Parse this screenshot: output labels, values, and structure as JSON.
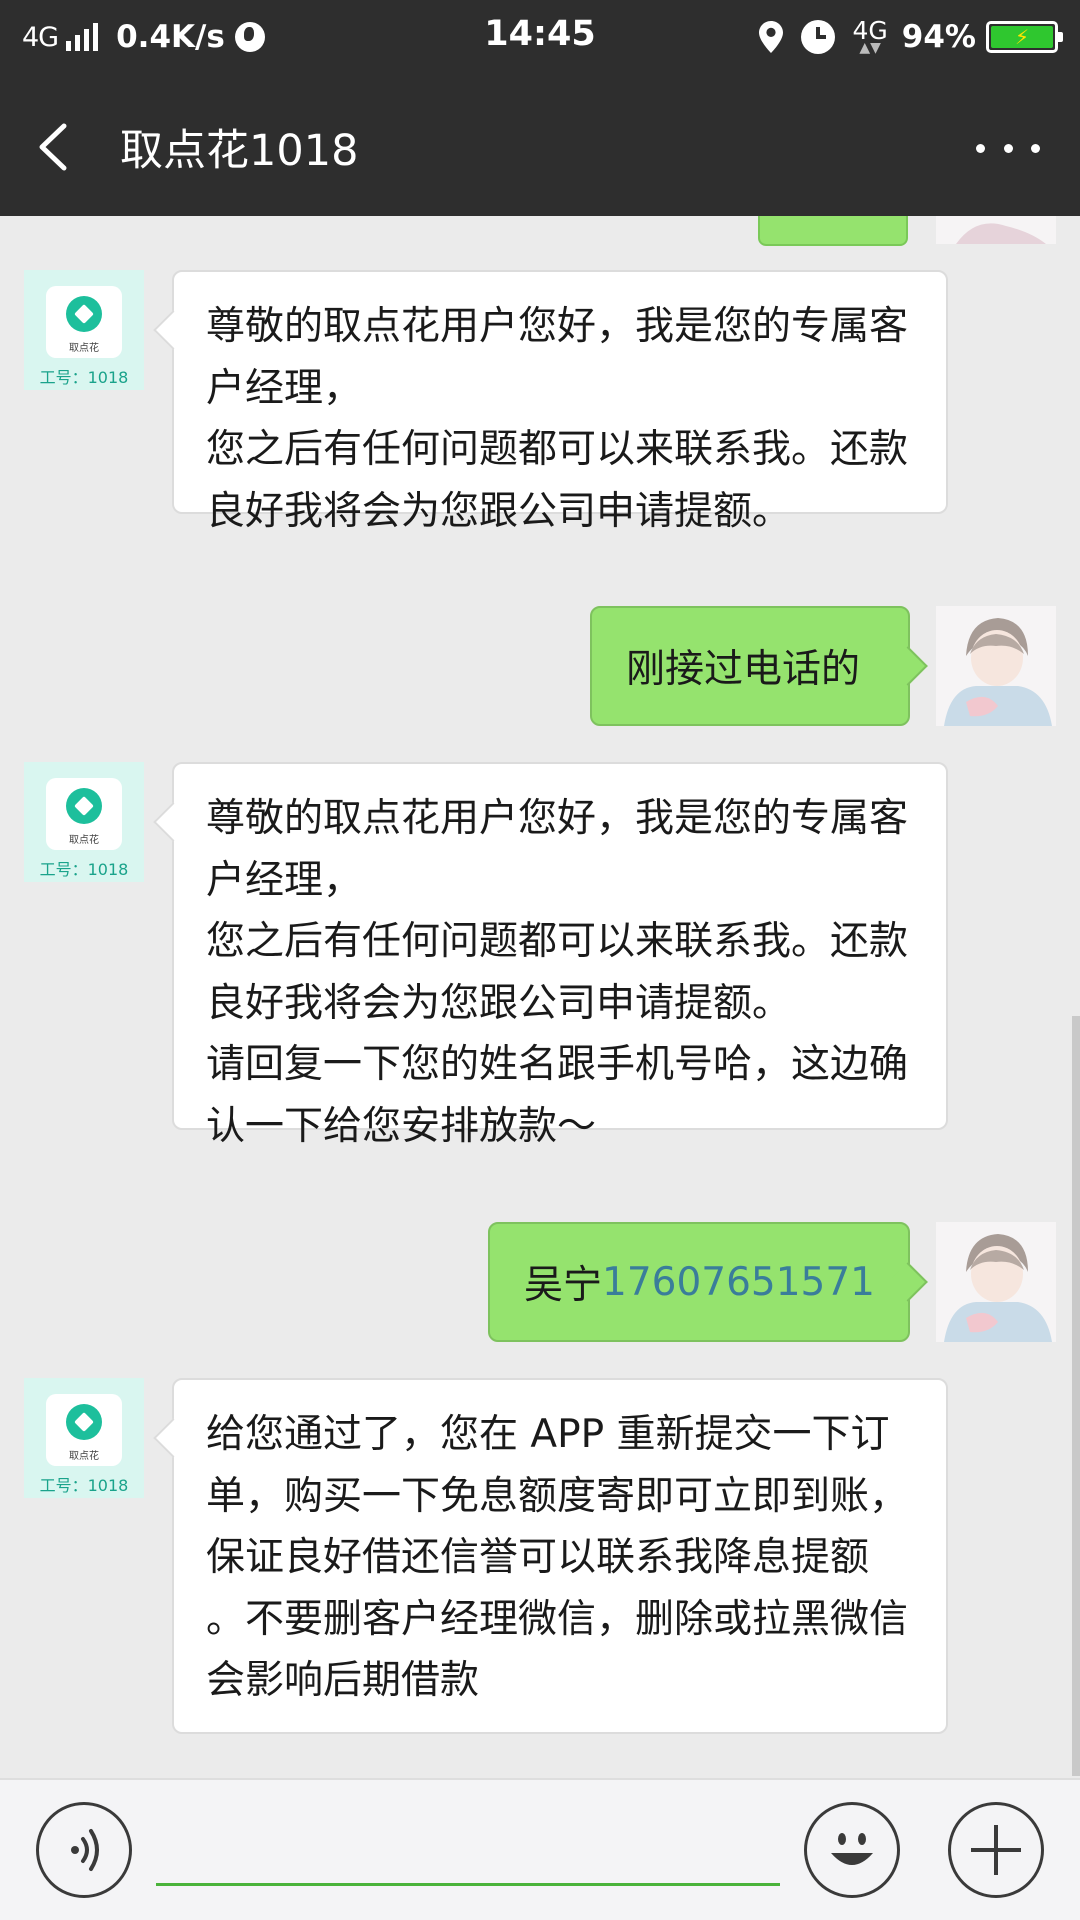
{
  "status_bar": {
    "network": "4G",
    "speed": "0.4K/s",
    "time": "14:45",
    "network_right": "4G",
    "battery": "94%",
    "icons": [
      "signal-icon",
      "globe-icon",
      "location-icon",
      "alarm-icon",
      "battery-icon"
    ]
  },
  "header": {
    "title": "取点花1018",
    "back_icon": "chevron-left-icon",
    "more_icon": "more-dots-icon"
  },
  "service_avatar": {
    "logo_text": "取点花",
    "employee_no": "工号：1018"
  },
  "messages": [
    {
      "side": "in",
      "text": "尊敬的取点花用户您好，我是您的专属客户经理，\n您之后有任何问题都可以来联系我。还款良好我将会为您跟公司申请提额。"
    },
    {
      "side": "out",
      "text": "刚接过电话的"
    },
    {
      "side": "in",
      "text": "尊敬的取点花用户您好，我是您的专属客户经理，\n您之后有任何问题都可以来联系我。还款良好我将会为您跟公司申请提额。\n请回复一下您的姓名跟手机号哈，这边确认一下给您安排放款～"
    },
    {
      "side": "out",
      "name": "吴宁",
      "phone": "17607651571"
    },
    {
      "side": "in",
      "text": "给您通过了，您在 APP 重新提交一下订单，购买一下免息额度寄即可立即到账，保证良好借还信誉可以联系我降息提额 。不要删客户经理微信，删除或拉黑微信会影响后期借款"
    }
  ],
  "input_bar": {
    "voice_icon": "voice-icon",
    "emoji_icon": "emoji-icon",
    "plus_icon": "plus-icon",
    "value": ""
  },
  "colors": {
    "header_bg": "#2e2e2e",
    "chat_bg": "#ebebeb",
    "outgoing_bubble": "#95e36e",
    "incoming_bubble": "#ffffff",
    "accent": "#4ab33a"
  }
}
